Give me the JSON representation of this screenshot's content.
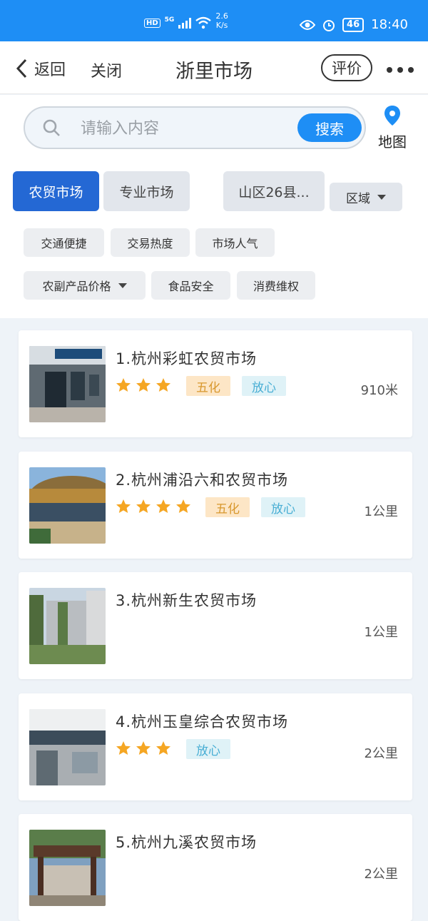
{
  "status_bar": {
    "network_tag": "HD",
    "network_gen": "5G",
    "speed": "2.6",
    "speed_unit": "K/s",
    "battery": "46",
    "time": "18:40"
  },
  "nav": {
    "back_label": "返回",
    "close_label": "关闭",
    "title": "浙里市场",
    "rate_label": "评价"
  },
  "search": {
    "placeholder": "请输入内容",
    "button_label": "搜索",
    "map_label": "地图"
  },
  "tabs": [
    {
      "label": "农贸市场",
      "active": true
    },
    {
      "label": "专业市场",
      "active": false
    },
    {
      "label": "山区26县...",
      "active": false
    }
  ],
  "area_dropdown": {
    "label": "区域"
  },
  "filter_chips_row1": [
    "交通便捷",
    "交易热度",
    "市场人气"
  ],
  "filter_chips_row2": [
    {
      "label": "农副产品价格",
      "dropdown": true
    },
    {
      "label": "食品安全"
    },
    {
      "label": "消费维权"
    }
  ],
  "markets": [
    {
      "title": "1.杭州彩虹农贸市场",
      "stars": 3,
      "badges": [
        "五化",
        "放心"
      ],
      "distance": "910米"
    },
    {
      "title": "2.杭州浦沿六和农贸市场",
      "stars": 4,
      "badges": [
        "五化",
        "放心"
      ],
      "distance": "1公里"
    },
    {
      "title": "3.杭州新生农贸市场",
      "stars": 0,
      "badges": [],
      "distance": "1公里"
    },
    {
      "title": "4.杭州玉皇综合农贸市场",
      "stars": 3,
      "badges": [
        "放心"
      ],
      "distance": "2公里"
    },
    {
      "title": "5.杭州九溪农贸市场",
      "stars": 0,
      "badges": [],
      "distance": "2公里"
    }
  ],
  "colors": {
    "accent": "#1e8ef5",
    "tab_active": "#2468d4",
    "star": "#f5a623",
    "badge_orange_bg": "#fde6c6",
    "badge_orange_text": "#d8972d",
    "badge_cyan_bg": "#dff2f7",
    "badge_cyan_text": "#48aed4"
  }
}
